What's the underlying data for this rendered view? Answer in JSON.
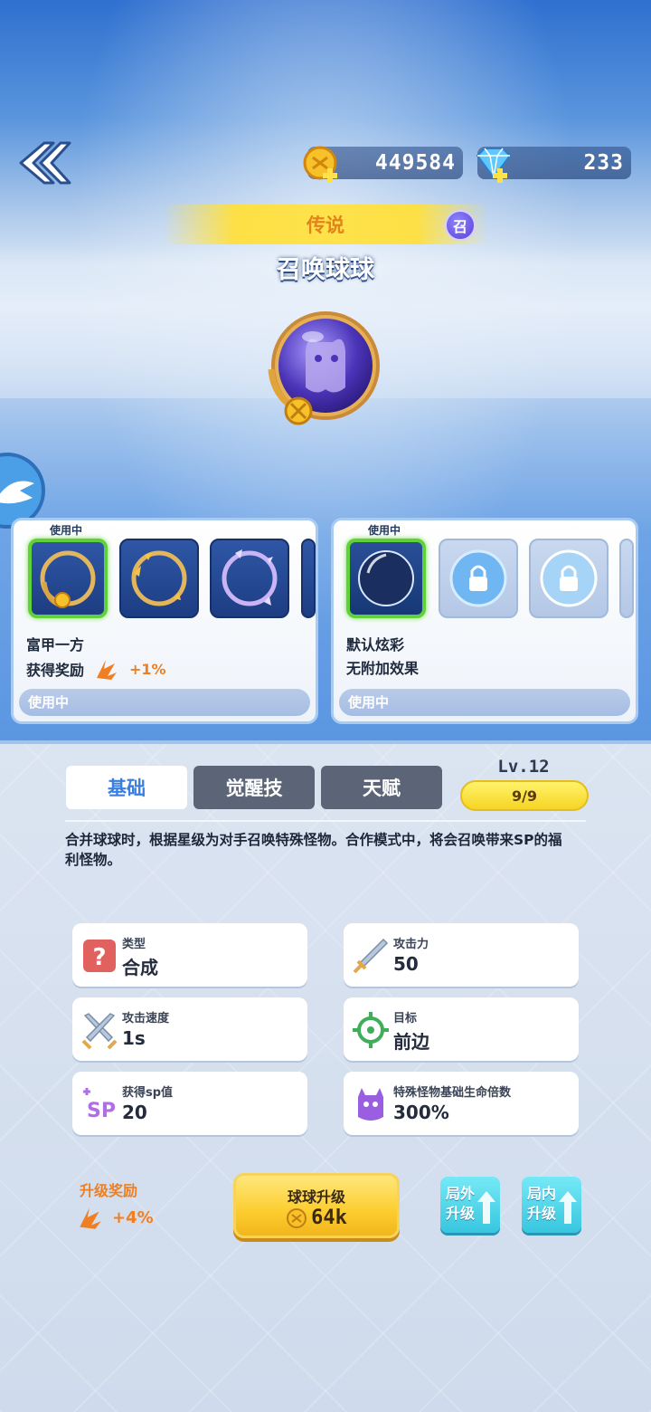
{
  "header": {
    "coins": "449584",
    "gems": "233"
  },
  "ball": {
    "rarity": "传说",
    "badge": "召",
    "name": "召唤球球"
  },
  "frame_panel": {
    "in_use_tag": "使用中",
    "item_name": "富甲一方",
    "effect_label": "获得奖励",
    "effect_bonus": "+1%",
    "status": "使用中"
  },
  "skin_panel": {
    "in_use_tag": "使用中",
    "item_name": "默认炫彩",
    "effect_label": "无附加效果",
    "status": "使用中"
  },
  "tabs": {
    "basic": "基础",
    "awaken": "觉醒技",
    "talent": "天赋"
  },
  "level": {
    "label": "Lv.12",
    "progress": "9/9"
  },
  "description": "合并球球时，根据星级为对手召唤特殊怪物。合作模式中，将会召唤带来SP的福利怪物。",
  "stats": {
    "type": {
      "label": "类型",
      "value": "合成"
    },
    "attack": {
      "label": "攻击力",
      "value": "50"
    },
    "speed": {
      "label": "攻击速度",
      "value": "1s"
    },
    "target": {
      "label": "目标",
      "value": "前边"
    },
    "sp": {
      "label": "获得sp值",
      "value": "20"
    },
    "hp_mult": {
      "label": "特殊怪物基础生命倍数",
      "value": "300%"
    }
  },
  "actions": {
    "reward_label": "升级奖励",
    "reward_value": "+4%",
    "upgrade_title": "球球升级",
    "upgrade_cost": "64k",
    "outside_upgrade": "局外升级",
    "inside_upgrade": "局内升级"
  },
  "colors": {
    "accent_orange": "#ef7f22",
    "selected_green": "#5fd13a",
    "tab_active_text": "#3a7fe0",
    "cyan_button": "#37c6df"
  }
}
